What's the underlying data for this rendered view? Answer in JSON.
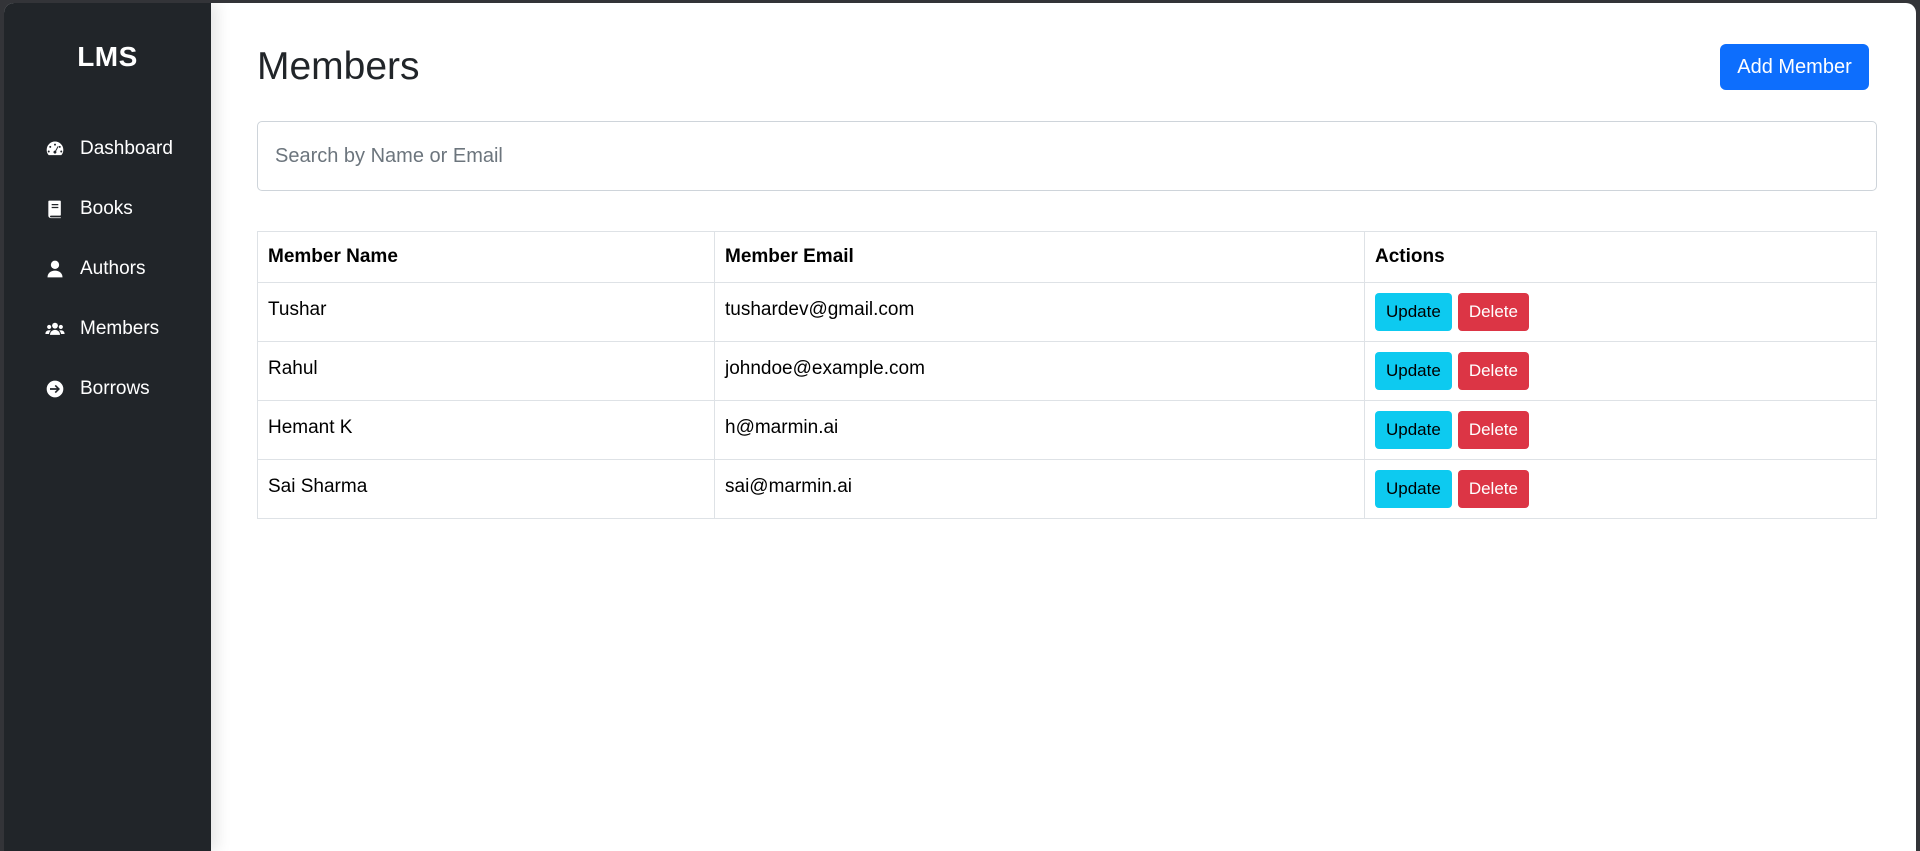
{
  "sidebar": {
    "brand": "LMS",
    "items": [
      {
        "label": "Dashboard",
        "icon": "dashboard-icon"
      },
      {
        "label": "Books",
        "icon": "book-icon"
      },
      {
        "label": "Authors",
        "icon": "user-icon"
      },
      {
        "label": "Members",
        "icon": "users-icon"
      },
      {
        "label": "Borrows",
        "icon": "arrow-circle-right-icon"
      }
    ]
  },
  "main": {
    "title": "Members",
    "add_button": "Add Member",
    "search_placeholder": "Search by Name or Email",
    "search_value": "",
    "table": {
      "headers": [
        "Member Name",
        "Member Email",
        "Actions"
      ],
      "rows": [
        {
          "name": "Tushar",
          "email": "tushardev@gmail.com"
        },
        {
          "name": "Rahul",
          "email": "johndoe@example.com"
        },
        {
          "name": "Hemant K",
          "email": "h@marmin.ai"
        },
        {
          "name": "Sai Sharma",
          "email": "sai@marmin.ai"
        }
      ],
      "update_label": "Update",
      "delete_label": "Delete"
    }
  },
  "colors": {
    "sidebar_bg": "#212529",
    "primary": "#0d6efd",
    "info": "#0dcaf0",
    "danger": "#dc3545"
  }
}
